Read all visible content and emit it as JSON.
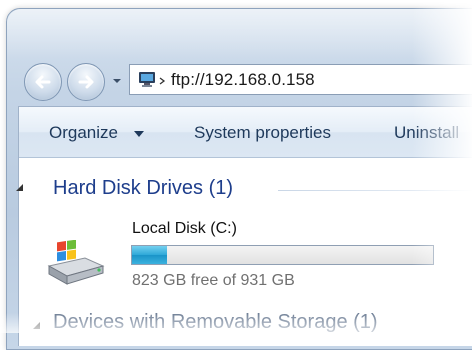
{
  "address_bar": {
    "url": "ftp://192.168.0.158",
    "location_icon": "computer-icon"
  },
  "nav": {
    "back_icon": "back-arrow-icon",
    "forward_icon": "forward-arrow-icon",
    "history_icon": "chevron-down-icon"
  },
  "toolbar": {
    "organize_label": "Organize",
    "system_properties_label": "System properties",
    "uninstall_label": "Uninstall"
  },
  "groups": [
    {
      "title": "Hard Disk Drives (1)",
      "drives": [
        {
          "name": "Local Disk (C:)",
          "free_text": "823 GB free of 931 GB",
          "used_fraction": 0.116
        }
      ]
    },
    {
      "title": "Devices with Removable Storage (1)"
    }
  ],
  "colors": {
    "accent": "#1e3e8c",
    "bar_fill": "#2da8d8"
  }
}
